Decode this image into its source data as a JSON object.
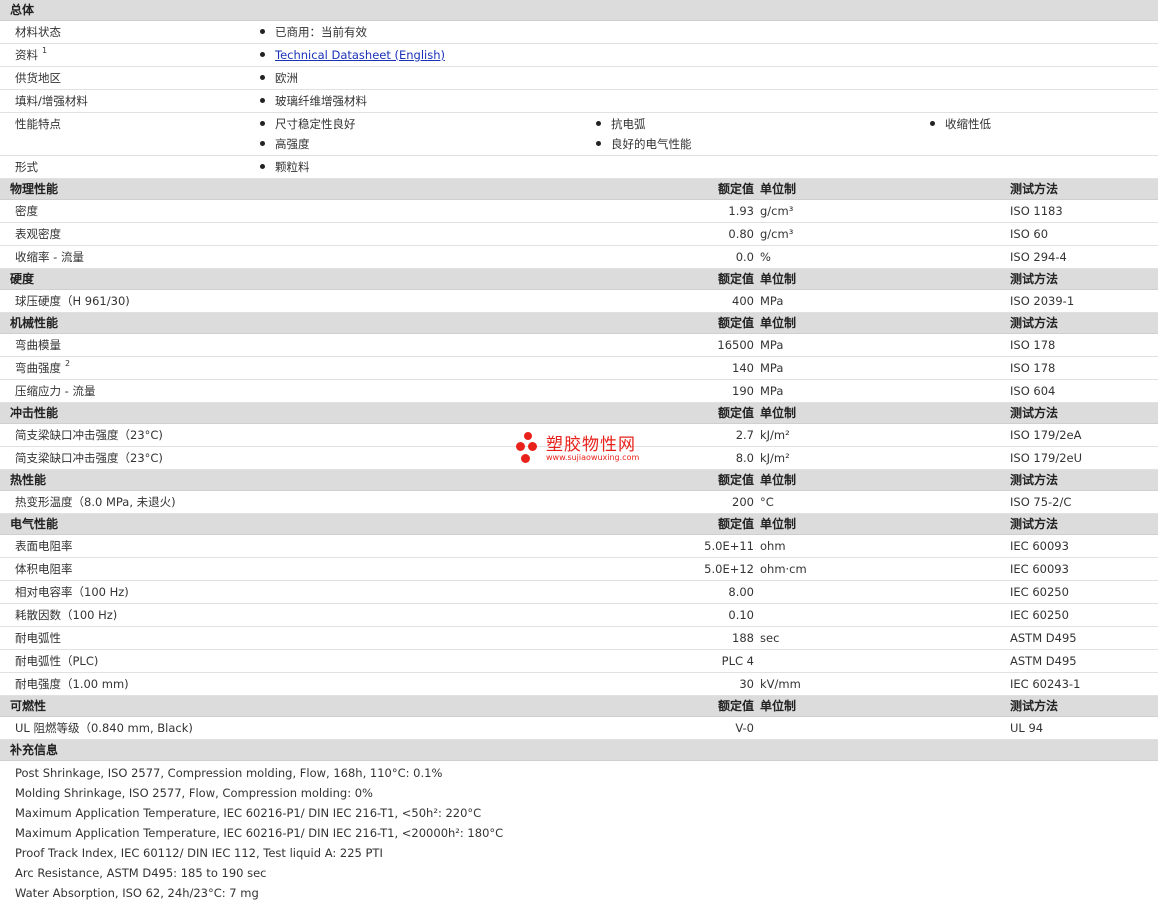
{
  "hdr": {
    "value": "额定值",
    "unit": "单位制",
    "method": "测试方法"
  },
  "general": {
    "title": "总体",
    "status_label": "材料状态",
    "status": "已商用：当前有效",
    "docs_label": "资料",
    "docs_sup": "1",
    "docs_link": "Technical Datasheet (English)",
    "region_label": "供货地区",
    "region": "欧洲",
    "filler_label": "填料/增强材料",
    "filler": "玻璃纤维增强材料",
    "features_label": "性能特点",
    "features": [
      "尺寸稳定性良好",
      "抗电弧",
      "收缩性低",
      "高强度",
      "良好的电气性能"
    ],
    "form_label": "形式",
    "form": "颗粒料"
  },
  "sections": [
    {
      "title": "物理性能",
      "rows": [
        {
          "label": "密度",
          "value": "1.93",
          "unit": "g/cm³",
          "method": "ISO 1183"
        },
        {
          "label": "表观密度",
          "value": "0.80",
          "unit": "g/cm³",
          "method": "ISO 60"
        },
        {
          "label": "收缩率  - 流量",
          "value": "0.0",
          "unit": "%",
          "method": "ISO 294-4"
        }
      ]
    },
    {
      "title": "硬度",
      "rows": [
        {
          "label": "球压硬度（H 961/30)",
          "value": "400",
          "unit": "MPa",
          "method": "ISO 2039-1"
        }
      ]
    },
    {
      "title": "机械性能",
      "rows": [
        {
          "label": "弯曲模量",
          "value": "16500",
          "unit": "MPa",
          "method": "ISO 178"
        },
        {
          "label": "弯曲强度",
          "sup": "2",
          "value": "140",
          "unit": "MPa",
          "method": "ISO 178"
        },
        {
          "label": "压缩应力  - 流量",
          "value": "190",
          "unit": "MPa",
          "method": "ISO 604"
        }
      ]
    },
    {
      "title": "冲击性能",
      "rows": [
        {
          "label": "简支梁缺口冲击强度（23°C)",
          "value": "2.7",
          "unit": "kJ/m²",
          "method": "ISO 179/2eA"
        },
        {
          "label": "简支梁缺口冲击强度（23°C)",
          "value": "8.0",
          "unit": "kJ/m²",
          "method": "ISO 179/2eU"
        }
      ]
    },
    {
      "title": "热性能",
      "rows": [
        {
          "label": "热变形温度（8.0 MPa, 未退火)",
          "value": "200",
          "unit": "°C",
          "method": "ISO 75-2/C"
        }
      ]
    },
    {
      "title": "电气性能",
      "rows": [
        {
          "label": "表面电阻率",
          "value": "5.0E+11",
          "unit": "ohm",
          "method": "IEC 60093"
        },
        {
          "label": "体积电阻率",
          "value": "5.0E+12",
          "unit": "ohm·cm",
          "method": "IEC 60093"
        },
        {
          "label": "相对电容率（100 Hz)",
          "value": "8.00",
          "unit": "",
          "method": "IEC 60250"
        },
        {
          "label": "耗散因数（100 Hz)",
          "value": "0.10",
          "unit": "",
          "method": "IEC 60250"
        },
        {
          "label": "耐电弧性",
          "value": "188",
          "unit": "sec",
          "method": "ASTM D495"
        },
        {
          "label": "耐电弧性（PLC)",
          "value": "PLC 4",
          "unit": "",
          "method": "ASTM D495"
        },
        {
          "label": "耐电强度（1.00 mm)",
          "value": "30",
          "unit": "kV/mm",
          "method": "IEC 60243-1"
        }
      ]
    },
    {
      "title": "可燃性",
      "rows": [
        {
          "label": "UL 阻燃等级（0.840 mm, Black)",
          "value": "V-0",
          "unit": "",
          "method": "UL 94"
        }
      ]
    }
  ],
  "supplement": {
    "title": "补充信息",
    "lines": [
      "Post Shrinkage, ISO 2577, Compression molding, Flow, 168h, 110°C: 0.1%",
      "Molding Shrinkage, ISO 2577, Flow, Compression molding: 0%",
      "Maximum Application Temperature, IEC 60216-P1/ DIN IEC 216-T1, <50h²: 220°C",
      "Maximum Application Temperature, IEC 60216-P1/ DIN IEC 216-T1, <20000h²: 180°C",
      "Proof Track Index, IEC 60112/ DIN IEC 112, Test liquid A: 225 PTI",
      "Arc Resistance, ASTM D495: 185 to 190 sec",
      "Water Absorption, ISO 62, 24h/23°C: 7 mg"
    ]
  },
  "watermark": {
    "name": "塑胶物性网",
    "url": "www.sujiaowuxing.com",
    "color": "#e8221b"
  }
}
